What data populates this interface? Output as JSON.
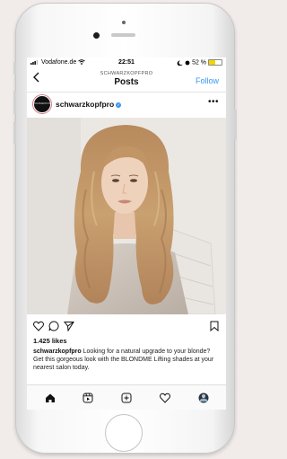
{
  "status_bar": {
    "carrier": "Vodafone.de",
    "time": "22:51",
    "battery": "52 %",
    "battery_level": 0.52
  },
  "nav": {
    "account": "SCHWARZKOPFPRO",
    "title": "Posts",
    "follow_label": "Follow"
  },
  "post": {
    "username": "schwarzkopfpro",
    "avatar_text": "SCHWARZKOPF",
    "likes": "1.425 likes",
    "caption_user": "schwarzkopfpro",
    "caption_text": "Looking for a natural upgrade to your blonde? Get this gorgeous look with the BLONDME Lifting shades at your nearest salon today."
  },
  "icons": {
    "actions": [
      "heart-icon",
      "comment-icon",
      "share-icon",
      "bookmark-icon"
    ],
    "tabs": [
      "home-icon",
      "reels-icon",
      "new-post-icon",
      "activity-icon",
      "profile-icon"
    ]
  },
  "colors": {
    "accent": "#3897f0",
    "battery": "#f2d40d",
    "background": "#f1ecea"
  }
}
